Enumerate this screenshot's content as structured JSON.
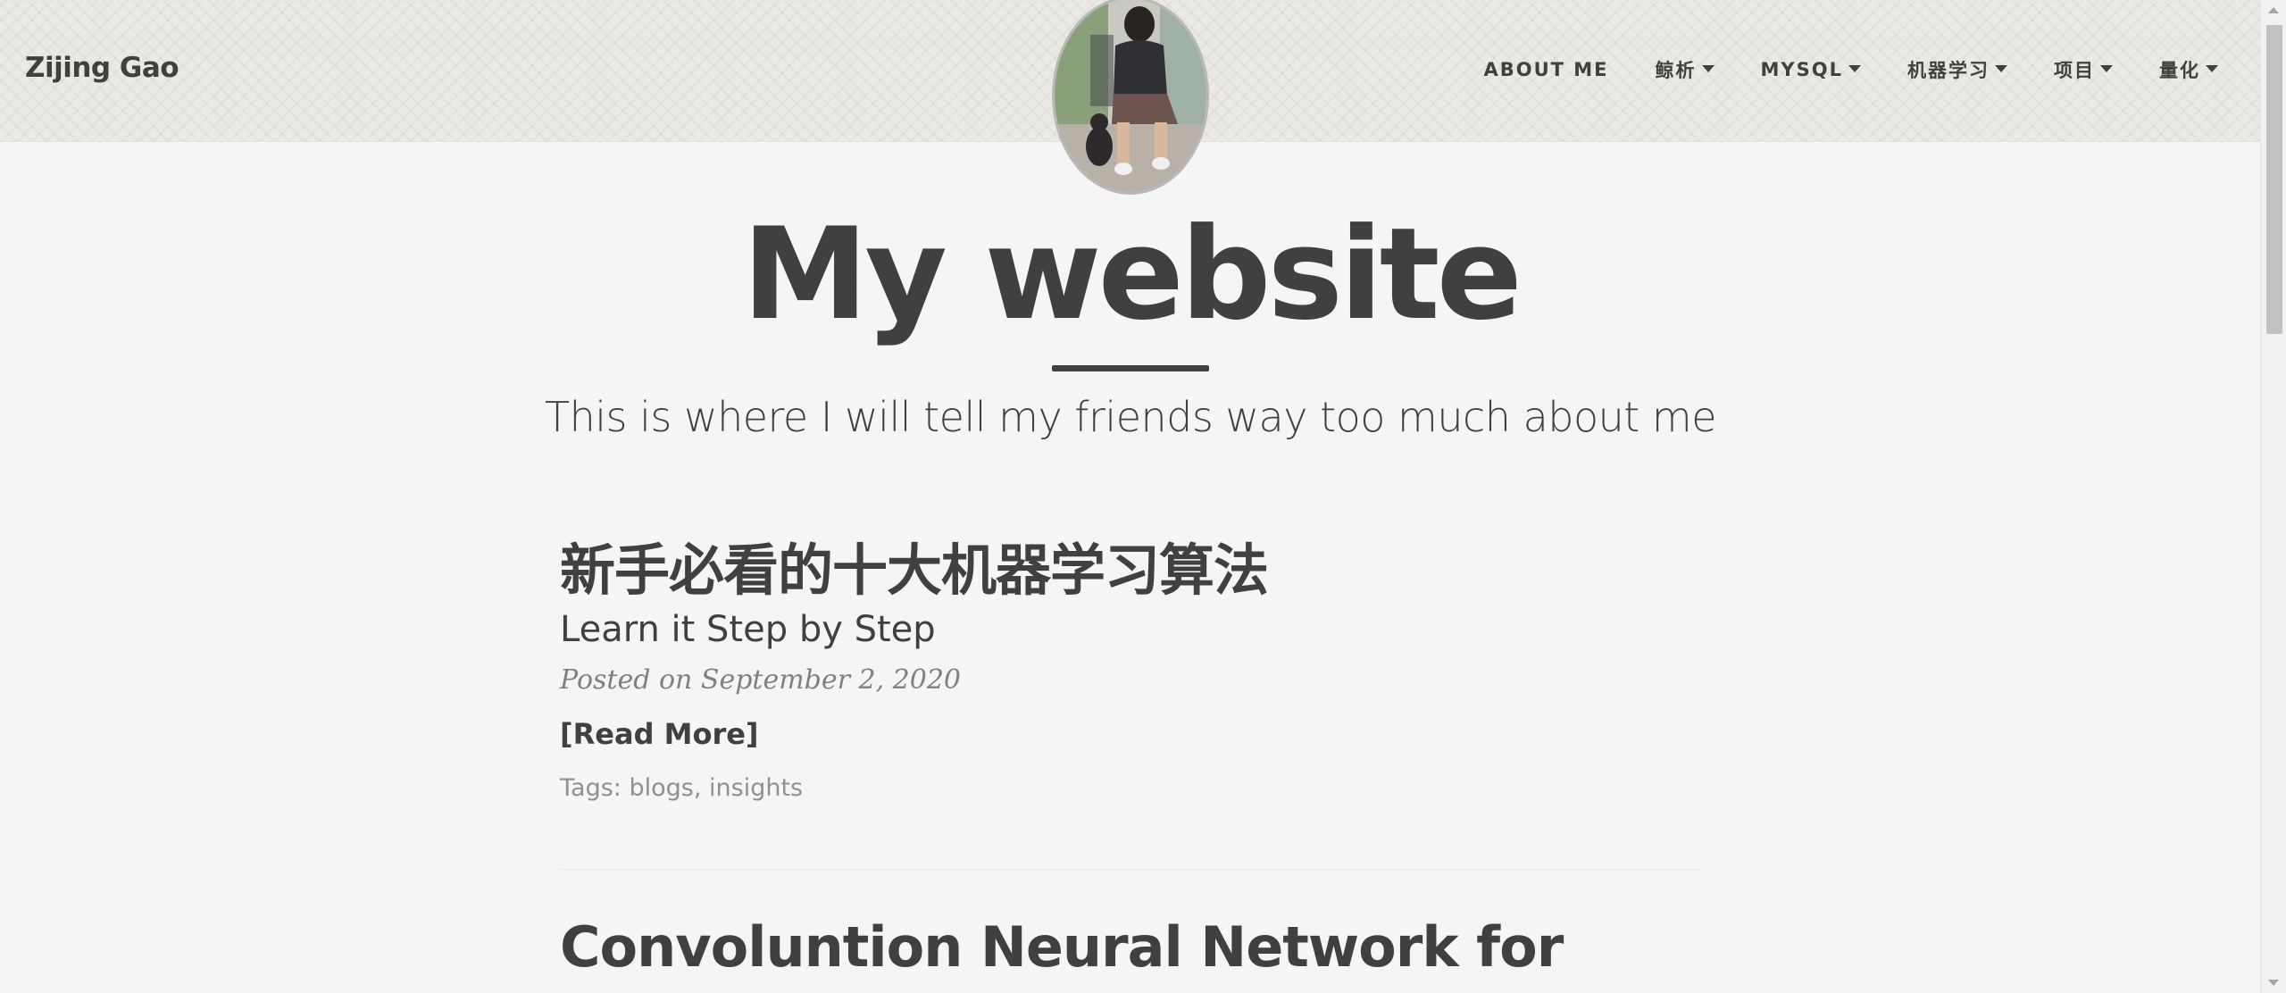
{
  "navbar": {
    "brand": "Zijing Gao",
    "items": [
      {
        "label": "ABOUT ME",
        "dropdown": false
      },
      {
        "label": "鲸析",
        "dropdown": true
      },
      {
        "label": "MYSQL",
        "dropdown": true
      },
      {
        "label": "机器学习",
        "dropdown": true
      },
      {
        "label": "项目",
        "dropdown": true
      },
      {
        "label": "量化",
        "dropdown": true
      }
    ]
  },
  "header": {
    "title": "My website",
    "subtitle": "This is where I will tell my friends way too much about me"
  },
  "posts": [
    {
      "title": "新手必看的十大机器学习算法",
      "subtitle": "Learn it Step by Step",
      "meta": "Posted on September 2, 2020",
      "read_more": "[Read More]",
      "tags_label": "Tags:",
      "tags": [
        "blogs",
        "insights"
      ]
    },
    {
      "title": "Convoluntion Neural Network for"
    }
  ],
  "colors": {
    "text": "#404040",
    "muted": "#808080",
    "background": "#f5f5f5",
    "navbar_bg": "#ebe9e4"
  },
  "icons": {
    "dropdown": "caret-down-icon",
    "avatar": "profile-photo"
  }
}
